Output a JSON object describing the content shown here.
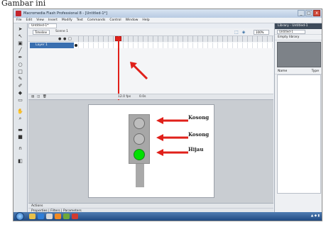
{
  "caption": "Gambar ini",
  "window": {
    "title": "Macromedia Flash Professional 8 - [Untitled-1*]",
    "minimize": "_",
    "maximize": "□",
    "close": "x"
  },
  "menu": [
    "File",
    "Edit",
    "View",
    "Insert",
    "Modify",
    "Text",
    "Commands",
    "Control",
    "Window",
    "Help"
  ],
  "document_tab": "Untitled-1*",
  "edit_bar": {
    "timeline_button": "Timeline",
    "scene": "Scene 1",
    "zoom": "100%"
  },
  "timeline": {
    "layer_name": "Layer 1",
    "footer_fps": "12.0 fps",
    "footer_time": "0.0s"
  },
  "stage_labels": [
    "Kosong",
    "Kosong",
    "Hijau"
  ],
  "colors": {
    "light_on": "#00e000",
    "arrow": "#e0201a",
    "playhead": "#e0201a"
  },
  "bottom_panels": [
    "Actions",
    "Properties | Filters | Parameters"
  ],
  "right_panel": {
    "title": "Library - Untitled-1",
    "document": "Untitled-1",
    "status": "Empty library",
    "name_col": "Name",
    "type_col": "Type"
  }
}
